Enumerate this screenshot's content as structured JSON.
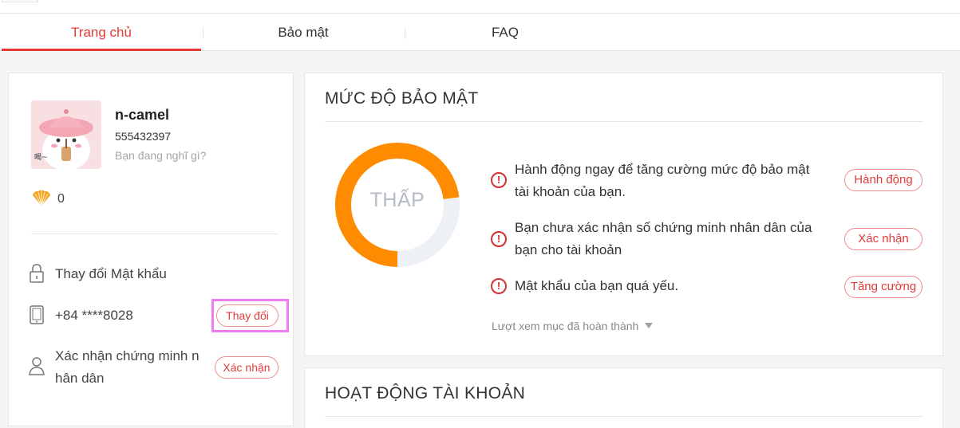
{
  "tabs": [
    {
      "label": "Trang chủ",
      "active": true
    },
    {
      "label": "Bảo mật",
      "active": false
    },
    {
      "label": "FAQ",
      "active": false
    }
  ],
  "profile": {
    "username": "n-camel",
    "user_id": "555432397",
    "status_placeholder": "Bạn đang nghĩ gì?",
    "coins": "0",
    "change_password_label": "Thay đổi Mật khẩu",
    "phone": "+84 ****8028",
    "phone_button": "Thay đổi",
    "id_verify_label_line1": "Xác nhận chứng minh n",
    "id_verify_label_line2": "hân dân",
    "id_verify_button": "Xác nhận"
  },
  "security": {
    "title": "MỨC ĐỘ BẢO MẬT",
    "level": "THẤP",
    "level_fraction": 0.73,
    "items": [
      {
        "text_line1": "Hành động ngay để tăng cường mức độ bảo mật",
        "text_line2": "tài khoản của bạn.",
        "button": "Hành động"
      },
      {
        "text_line1": "Bạn chưa xác nhận số chứng minh nhân dân của",
        "text_line2": "bạn cho tài khoản",
        "button": "Xác nhận"
      },
      {
        "text_line1": "Mật khẩu của bạn quá yếu.",
        "text_line2": "",
        "button": "Tăng cường"
      }
    ],
    "view_completed": "Lượt xem mục đã hoàn thành"
  },
  "activity": {
    "title": "HOẠT ĐỘNG TÀI KHOẢN"
  },
  "colors": {
    "accent": "#e53935",
    "donut_fill": "#ff8c00",
    "donut_track": "#edf1f5",
    "highlight": "#f27cf2"
  }
}
